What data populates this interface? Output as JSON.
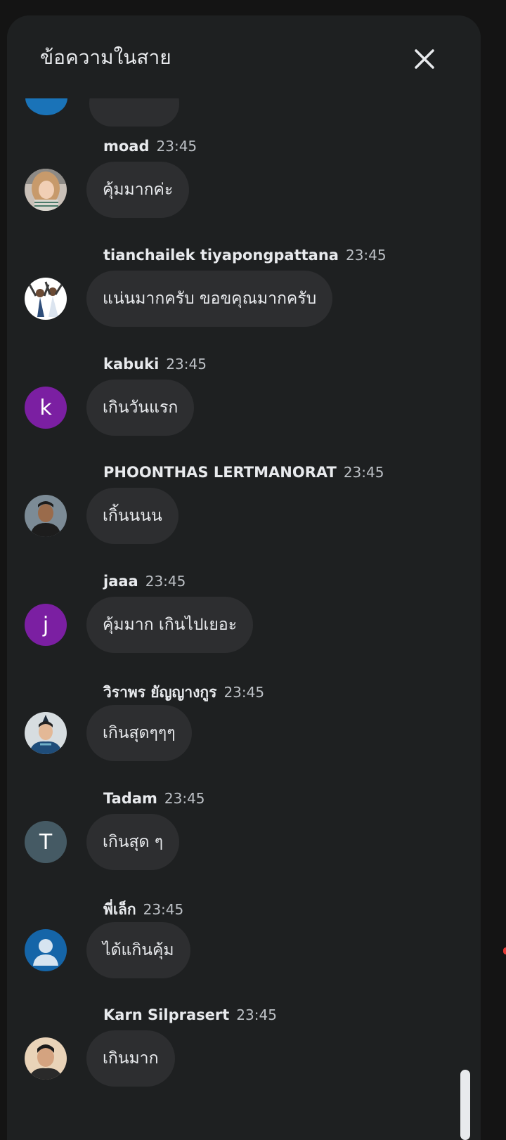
{
  "panel": {
    "title": "ข้อความในสาย",
    "close_label": "close"
  },
  "messages": [
    {
      "author": "moad",
      "time": "23:45",
      "text": "คุ้มมากค่ะ",
      "avatar": "photo",
      "initial": ""
    },
    {
      "author": "tianchailek tiyapongpattana",
      "time": "23:45",
      "text": "แน่นมากครับ ขอขคุณมากครับ",
      "avatar": "photo",
      "initial": ""
    },
    {
      "author": "kabuki",
      "time": "23:45",
      "text": "เกินวันแรก",
      "avatar": "initial",
      "initial": "k"
    },
    {
      "author": "PHOONTHAS LERTMANORAT",
      "time": "23:45",
      "text": "เกิ้นนนน",
      "avatar": "photo",
      "initial": ""
    },
    {
      "author": "jaaa",
      "time": "23:45",
      "text": "คุ้มมาก เกินไปเยอะ",
      "avatar": "initial",
      "initial": "j"
    },
    {
      "author": "วิราพร ยัญญางกูร",
      "time": "23:45",
      "text": "เกินสุดๆๆๆ",
      "avatar": "photo",
      "initial": ""
    },
    {
      "author": "Tadam",
      "time": "23:45",
      "text": "เกินสุด ๆ",
      "avatar": "initial",
      "initial": "T"
    },
    {
      "author": "พี่เล็ก",
      "time": "23:45",
      "text": "ได้แกินคุ้ม",
      "avatar": "default",
      "initial": ""
    },
    {
      "author": "Karn Silprasert",
      "time": "23:45",
      "text": "เกินมาก",
      "avatar": "photo",
      "initial": ""
    }
  ],
  "colors": {
    "background": "#141414",
    "panel": "#1e2021",
    "bubble": "#2d2e30",
    "text": "#e8eaed",
    "purple_avatar": "#7b1fa2",
    "slate_avatar": "#455a64",
    "default_avatar": "#1565a8"
  },
  "icons": {
    "close": "close-icon",
    "default_avatar": "person-icon"
  }
}
